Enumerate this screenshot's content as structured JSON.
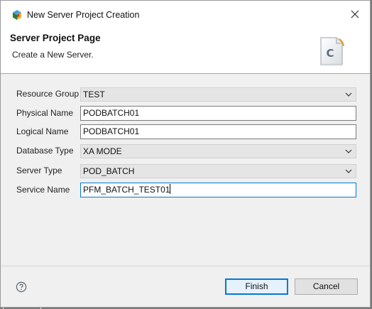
{
  "window": {
    "title": "New Server Project Creation",
    "close_icon": "close-icon"
  },
  "banner": {
    "title": "Server Project Page",
    "description": "Create a New Server.",
    "icon": "class-file-icon",
    "icon_letter": "C"
  },
  "form": {
    "resource_group": {
      "label": "Resource Group",
      "value": "TEST"
    },
    "physical_name": {
      "label": "Physical Name",
      "value": "PODBATCH01"
    },
    "logical_name": {
      "label": "Logical Name",
      "value": "PODBATCH01"
    },
    "database_type": {
      "label": "Database Type",
      "value": "XA MODE"
    },
    "server_type": {
      "label": "Server Type",
      "value": "POD_BATCH"
    },
    "service_name": {
      "label": "Service Name",
      "value": "PFM_BATCH_TEST01"
    }
  },
  "footer": {
    "help_icon": "help-icon",
    "finish_label": "Finish",
    "cancel_label": "Cancel"
  },
  "colors": {
    "accent": "#0078d7",
    "dialog_bg": "#f0f0f0",
    "combo_bg": "#e5e5e5"
  }
}
